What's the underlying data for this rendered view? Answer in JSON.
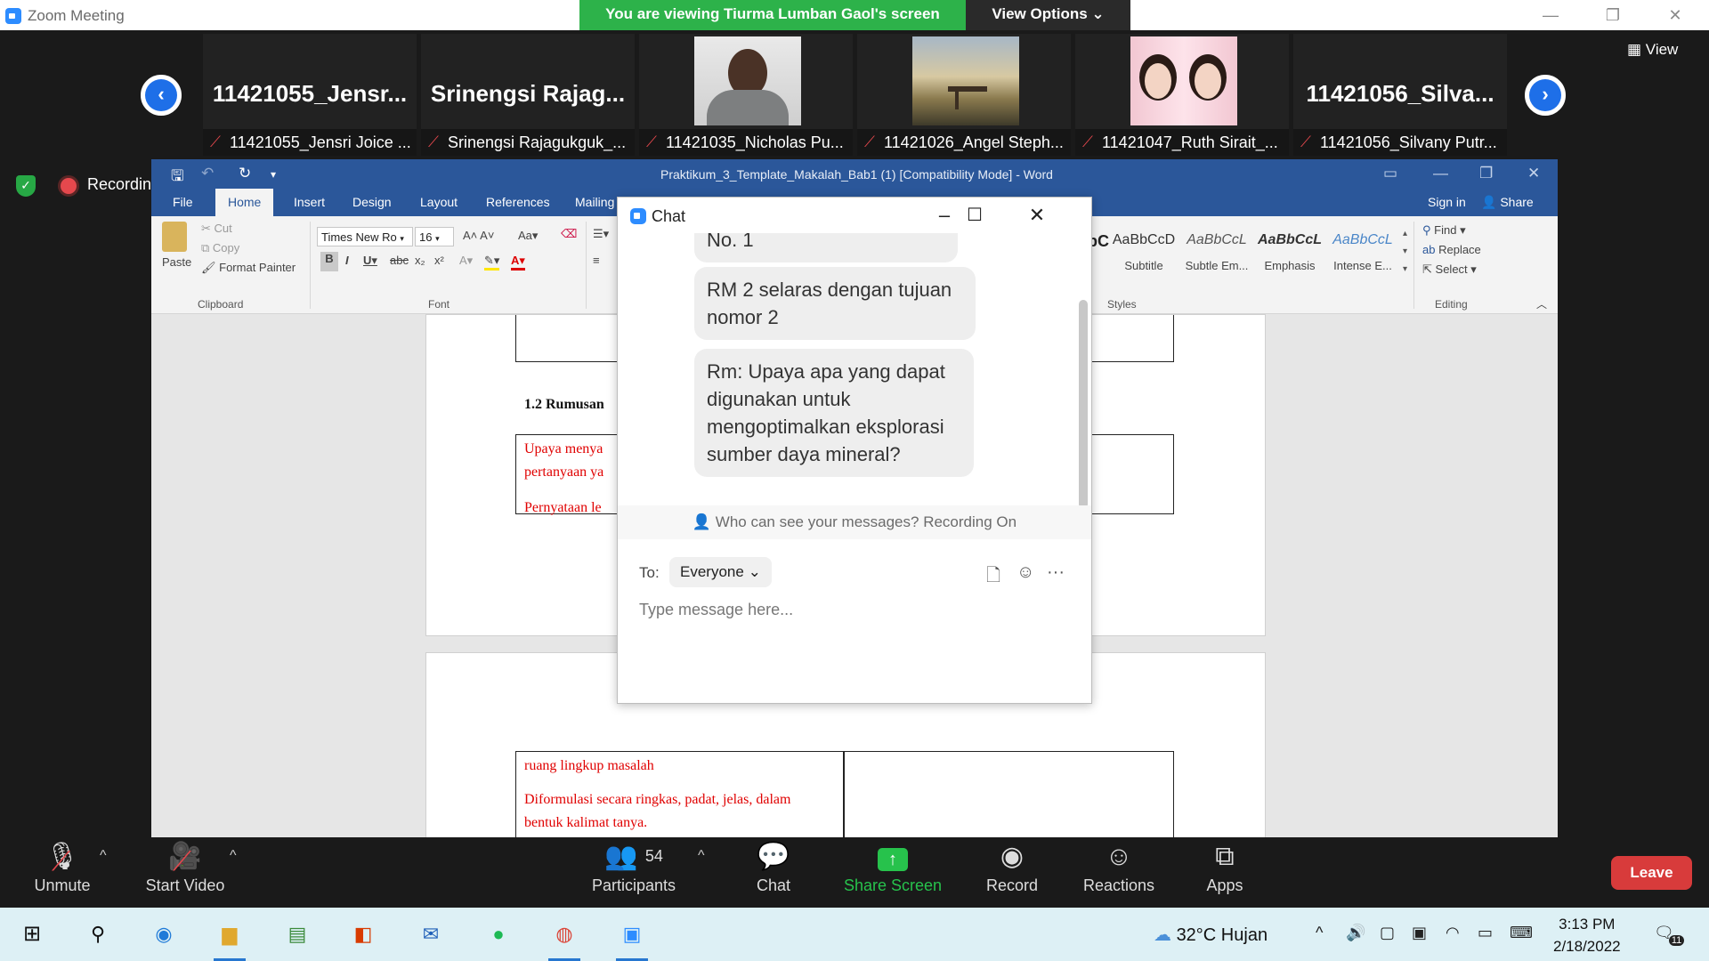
{
  "window": {
    "title": "Zoom Meeting",
    "viewing_banner": "You are viewing Tiurma Lumban Gaol's screen",
    "view_options": "View Options"
  },
  "gallery": {
    "view_label": "View",
    "tiles": [
      {
        "display": "11421055_Jensr...",
        "label": "11421055_Jensri Joice ..."
      },
      {
        "display": "Srinengsi  Rajag...",
        "label": "Srinengsi Rajagukguk_..."
      },
      {
        "display": "",
        "label": "11421035_Nicholas Pu..."
      },
      {
        "display": "",
        "label": "11421026_Angel Steph..."
      },
      {
        "display": "",
        "label": "11421047_Ruth Sirait_..."
      },
      {
        "display": "11421056_Silva...",
        "label": "11421056_Silvany Putr..."
      }
    ]
  },
  "recording": {
    "label": "Recording"
  },
  "word": {
    "doc_title": "Praktikum_3_Template_Makalah_Bab1 (1) [Compatibility Mode] - Word",
    "tabs": [
      "File",
      "Home",
      "Insert",
      "Design",
      "Layout",
      "References",
      "Mailing"
    ],
    "sign_in": "Sign in",
    "share": "Share",
    "clipboard": {
      "paste": "Paste",
      "cut": "Cut",
      "copy": "Copy",
      "format_painter": "Format Painter",
      "label": "Clipboard"
    },
    "font": {
      "name": "Times New Ro",
      "size": "16",
      "label": "Font"
    },
    "styles": {
      "label": "Styles",
      "items": [
        {
          "sample": "AaBbCcD",
          "name": "Subtitle"
        },
        {
          "sample": "AaBbCcL",
          "name": "Subtle Em..."
        },
        {
          "sample": "AaBbCcL",
          "name": "Emphasis"
        },
        {
          "sample": "AaBbCcL",
          "name": "Intense E..."
        }
      ]
    },
    "editing": {
      "find": "Find",
      "replace": "Replace",
      "select": "Select",
      "label": "Editing"
    },
    "document": {
      "heading": "1.2  Rumusan",
      "red1": "Upaya menya",
      "red2": "pertanyaan ya",
      "red3": "Pernyataan  le",
      "red4": "ruang lingkup masalah",
      "red5": "Diformulasi secara ringkas, padat, jelas, dalam",
      "red6": "bentuk kalimat tanya."
    }
  },
  "chat": {
    "title": "Chat",
    "messages": [
      "No. 1",
      "RM 2 selaras dengan tujuan nomor 2",
      "Rm: Upaya apa yang dapat digunakan untuk mengoptimalkan eksplorasi sumber daya mineral?"
    ],
    "notice": "Who can see your messages? Recording On",
    "to_label": "To:",
    "recipient": "Everyone",
    "placeholder": "Type message here..."
  },
  "toolbar": {
    "unmute": "Unmute",
    "start_video": "Start Video",
    "participants": "Participants",
    "participant_count": "54",
    "chat": "Chat",
    "share_screen": "Share Screen",
    "record": "Record",
    "reactions": "Reactions",
    "apps": "Apps",
    "leave": "Leave"
  },
  "taskbar": {
    "weather": "32°C  Hujan",
    "time": "3:13 PM",
    "date": "2/18/2022",
    "notification_count": "11"
  },
  "colors": {
    "zoom_blue": "#2d8cff",
    "banner_green": "#2db24a",
    "word_blue": "#2b579a",
    "leave_red": "#d83b3b",
    "share_green": "#27c24c"
  }
}
